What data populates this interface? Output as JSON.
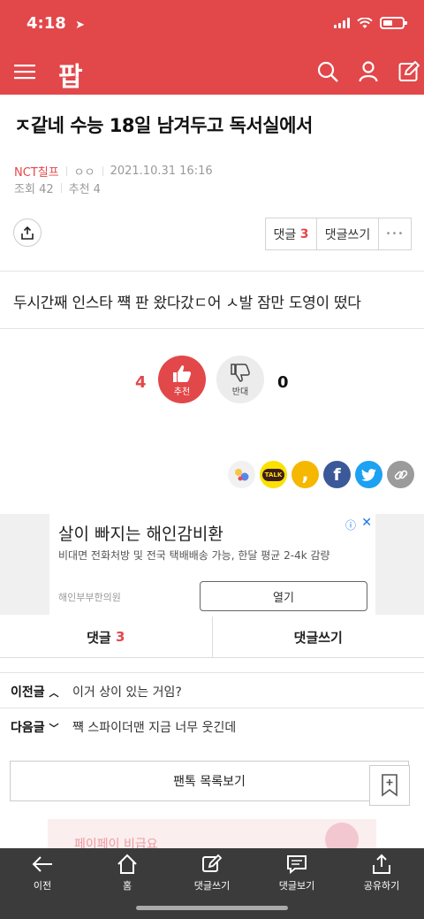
{
  "status_bar": {
    "time": "4:18"
  },
  "header": {
    "logo": "팝"
  },
  "post": {
    "title": "ㅈ같네 수능 18일 남겨두고 독서실에서",
    "author": "NCT칠프",
    "author_tag": "ㅇㅇ",
    "datetime": "2021.10.31 16:16",
    "views_label": "조회",
    "views": "42",
    "recommend_label": "추천",
    "recommend": "4",
    "body": "두시간째 인스타 쨱 판 왔다갔ㄷ어 ㅅ발 잠만 도영이 떴다"
  },
  "actions": {
    "comment_label": "댓글",
    "comment_count": "3",
    "write_comment": "댓글쓰기",
    "more": "•••"
  },
  "votes": {
    "up_count": "4",
    "up_label": "추천",
    "down_count": "0",
    "down_label": "반대"
  },
  "sns": {
    "kakao_talk": "TALK",
    "kakao_story": ",",
    "facebook": "f"
  },
  "ad": {
    "title": "살이 빠지는 해인감비환",
    "desc": "비대면 전화처방 및 전국 택배배송 가능, 한달 평균 2-4k 감량",
    "advertiser": "해인부부한의원",
    "open_label": "열기",
    "info": "ⓘ",
    "close": "✕"
  },
  "tabs": {
    "comment_label": "댓글",
    "comment_count": "3",
    "write_label": "댓글쓰기"
  },
  "prev": {
    "label": "이전글",
    "text": "이거 상이 있는 거임?"
  },
  "next": {
    "label": "다음글",
    "text": "쨱 스파이더맨 지금 너무 웃긴데"
  },
  "list_button": "팬톡 목록보기",
  "peek_text": "페이페이 비급요",
  "bottom_nav": [
    {
      "label": "이전",
      "icon": "arrow-left-icon"
    },
    {
      "label": "홈",
      "icon": "home-icon"
    },
    {
      "label": "댓글쓰기",
      "icon": "pencil-icon"
    },
    {
      "label": "댓글보기",
      "icon": "chat-icon"
    },
    {
      "label": "공유하기",
      "icon": "share-icon"
    }
  ],
  "colors": {
    "brand": "#e2474a",
    "facebook": "#3b5998",
    "twitter": "#1da1f2",
    "kakao": "#fae100",
    "link": "#9b9b9b"
  }
}
